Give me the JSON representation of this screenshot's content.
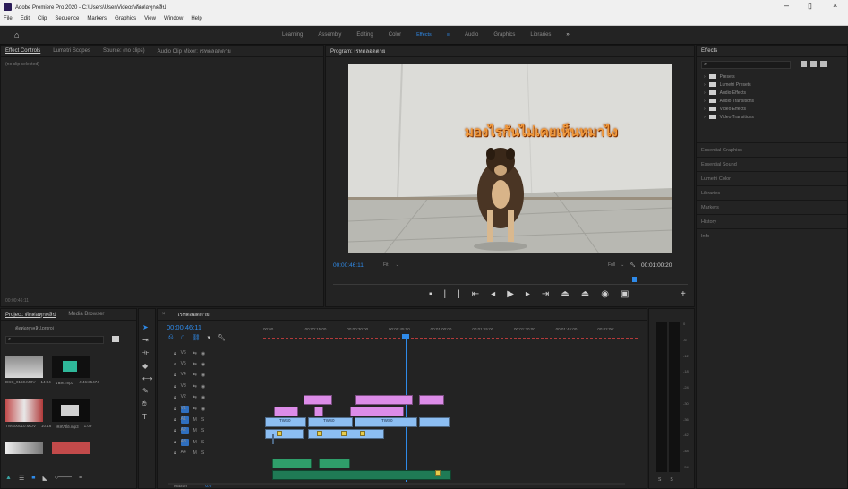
{
  "app": {
    "title": "Adobe Premiere Pro 2020 - C:\\Users\\User\\Videos\\ตัดต่อทุกคลิป"
  },
  "menu": [
    "File",
    "Edit",
    "Clip",
    "Sequence",
    "Markers",
    "Graphics",
    "View",
    "Window",
    "Help"
  ],
  "workspaces": {
    "items": [
      "Learning",
      "Assembly",
      "Editing",
      "Color",
      "Effects",
      "Audio",
      "Graphics",
      "Libraries"
    ],
    "active": "Effects",
    "more": "»"
  },
  "source_panel": {
    "tabs": [
      "Effect Controls",
      "Lumetri Scopes",
      "Source: (no clips)",
      "Audio Clip Mixer: เรทตลอดตาย"
    ],
    "empty_message": "(no clip selected)",
    "timecode": "00:00:46:11"
  },
  "program": {
    "tab": "Program: เรทตลอดตาย",
    "overlay_text": "มองไรกันไม่เคยเห็นหมาไง",
    "timecode": "00:00:46:11",
    "fit_label": "Fit",
    "quality": "Full",
    "duration": "00:01:00:20"
  },
  "project_panel": {
    "tabs": [
      "Project: ตัดต่อทุกคลิป",
      "Media Browser"
    ],
    "file_name": "ตัดต่อทุกคลิป.prproj",
    "items": [
      {
        "name": "DSC_0160.MOV",
        "duration": "14:04"
      },
      {
        "name": "เพลง.mp3",
        "duration": "4:46:35474"
      },
      {
        "name": "TWS00010.MOV",
        "duration": "10:16"
      },
      {
        "name": "คลิปชื่อ.mp3",
        "duration": "1:09"
      }
    ]
  },
  "timeline": {
    "tab": "เรทตลอดตาย",
    "timecode": "00:00:46:11",
    "ruler": [
      "00:00",
      "00:00:15:00",
      "00:00:30:00",
      "00:00:45:00",
      "00:01:00:00",
      "00:01:15:00",
      "00:01:30:00",
      "00:01:45:00",
      "00:02:00:"
    ],
    "video_tracks": [
      "V6",
      "V5",
      "V4",
      "V3",
      "V2",
      "V1"
    ],
    "audio_tracks": [
      "A1",
      "A2",
      "A3",
      "A4"
    ],
    "master_label": "Master",
    "master_value": "0.0",
    "clip_labels": [
      "TWS0",
      "TWS0",
      "TWS0"
    ]
  },
  "effects_panel": {
    "tab": "Effects",
    "folders": [
      "Presets",
      "Lumetri Presets",
      "Audio Effects",
      "Audio Transitions",
      "Video Effects",
      "Video Transitions"
    ],
    "sections": [
      "Essential Graphics",
      "Essential Sound",
      "Lumetri Color",
      "Libraries",
      "Markers",
      "History",
      "Info"
    ]
  },
  "audio_meter": {
    "scale": [
      "0",
      "-6",
      "-12",
      "-18",
      "-24",
      "-30",
      "-36",
      "-42",
      "-48",
      "-54"
    ],
    "solo_labels": [
      "S",
      "S"
    ]
  },
  "colors": {
    "accent": "#2f8ae8",
    "clip_pink": "#dc8ce8",
    "clip_blue": "#8cbef2",
    "audio_green": "#2f9e6a",
    "panel_bg": "#232323"
  }
}
